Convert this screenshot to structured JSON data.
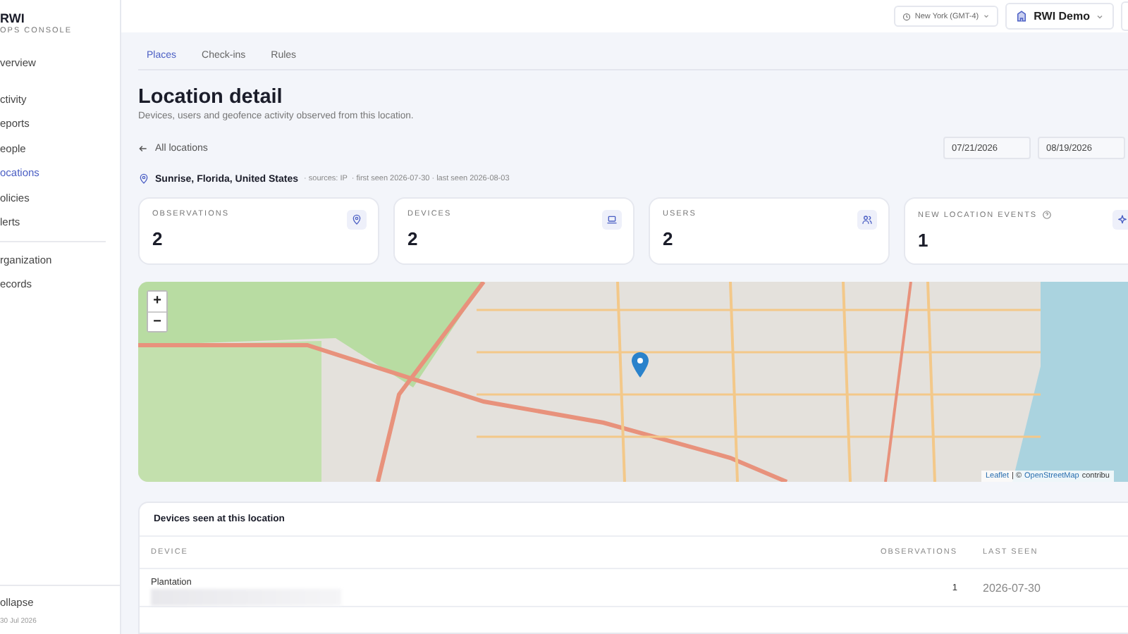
{
  "sidebar": {
    "brand": "RWI",
    "subtitle": "OPS CONSOLE",
    "sections": [
      {
        "items": [
          {
            "label": "verview",
            "selected": false
          }
        ]
      },
      {
        "items": [
          {
            "label": "ctivity",
            "selected": false
          },
          {
            "label": "eports",
            "selected": false
          },
          {
            "label": "eople",
            "selected": false
          },
          {
            "label": "ocations",
            "selected": true
          },
          {
            "label": "olicies",
            "selected": false
          },
          {
            "label": "lerts",
            "selected": false
          }
        ]
      },
      {
        "items": [
          {
            "label": "rganization",
            "selected": false
          },
          {
            "label": "ecords",
            "selected": false
          }
        ]
      }
    ],
    "collapse": "ollapse",
    "date": "30 Jul 2026"
  },
  "topbar": {
    "timezone": "New York (GMT-4)",
    "org": "RWI Demo"
  },
  "tabs": [
    {
      "label": "Places",
      "selected": true
    },
    {
      "label": "Check-ins",
      "selected": false
    },
    {
      "label": "Rules",
      "selected": false
    }
  ],
  "page": {
    "title": "Location detail",
    "subtitle": "Devices, users and geofence activity observed from this location.",
    "back": "All locations",
    "date_from": "07/21/2026",
    "date_to": "08/19/2026"
  },
  "location": {
    "name": "Sunrise, Florida, United States",
    "meta": "· sources: IP  · first seen 2026-07-30 · last seen 2026-08-03"
  },
  "stats": [
    {
      "kind": "pin",
      "label": "OBSERVATIONS",
      "value": "2",
      "help": false
    },
    {
      "kind": "laptop",
      "label": "DEVICES",
      "value": "2",
      "help": false
    },
    {
      "kind": "users",
      "label": "USERS",
      "value": "2",
      "help": false
    },
    {
      "kind": "sparkle",
      "label": "NEW LOCATION EVENTS",
      "value": "1",
      "help": true
    }
  ],
  "map": {
    "zoom_in": "+",
    "zoom_out": "−",
    "attribution": {
      "leaflet": "Leaflet",
      "separator": "| ©",
      "osm": "OpenStreetMap",
      "rest": "contribu"
    }
  },
  "devices": {
    "title": "Devices seen at this location",
    "columns": [
      "DEVICE",
      "OBSERVATIONS",
      "LAST SEEN"
    ],
    "rows": [
      {
        "device": "Plantation",
        "observations": "1",
        "last_seen": "2026-07-30"
      }
    ]
  }
}
